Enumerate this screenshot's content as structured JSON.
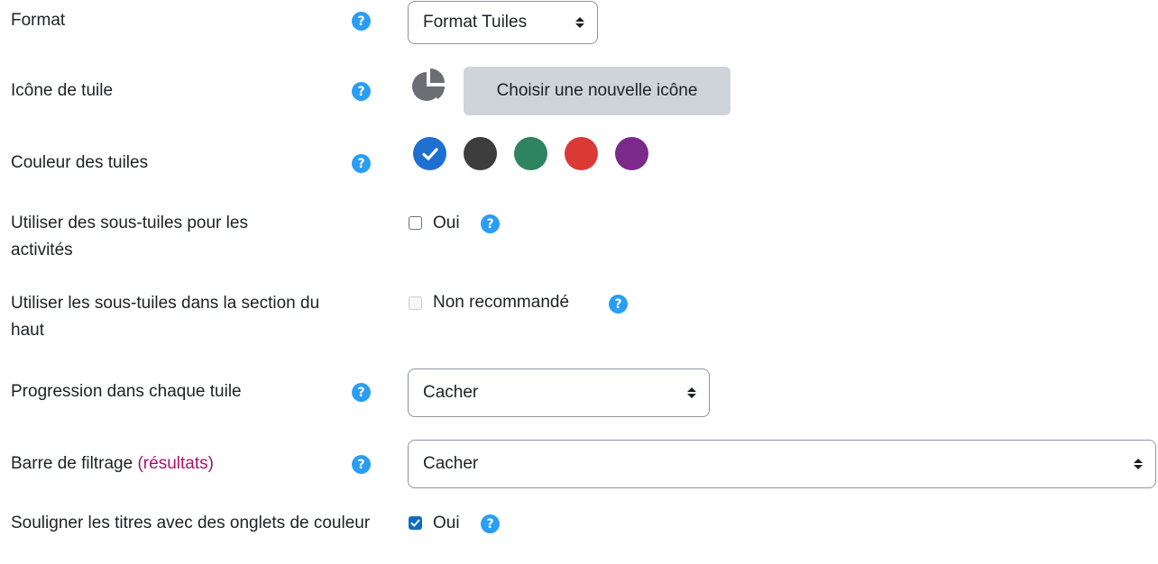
{
  "rows": {
    "format": {
      "label": "Format",
      "select_value": "Format Tuiles"
    },
    "tile_icon": {
      "label": "Icône de tuile",
      "button_label": "Choisir une nouvelle icône",
      "icon": "pie-chart-icon"
    },
    "tile_color": {
      "label": "Couleur des tuiles",
      "colors": [
        "#1f6fd1",
        "#3d3d3d",
        "#2e8360",
        "#d93a36",
        "#7b2a8c"
      ],
      "selected_index": 0
    },
    "subtiles_activities": {
      "label": "Utiliser des sous-tuiles pour les activités",
      "checkbox_label": "Oui",
      "checked": false
    },
    "subtiles_top": {
      "label": "Utiliser les sous-tuiles dans la section du haut",
      "checkbox_label": "Non recommandé",
      "disabled": true
    },
    "progress": {
      "label": "Progression dans chaque tuile",
      "select_value": "Cacher"
    },
    "filter_bar": {
      "label": "Barre de filtrage",
      "label_accent": "(résultats)",
      "select_value": "Cacher"
    },
    "underline_titles": {
      "label": "Souligner les titres avec des onglets de couleur",
      "checkbox_label": "Oui",
      "checked": true
    }
  },
  "help_icon": {
    "glyph": "?",
    "color": "#2a9df4"
  }
}
